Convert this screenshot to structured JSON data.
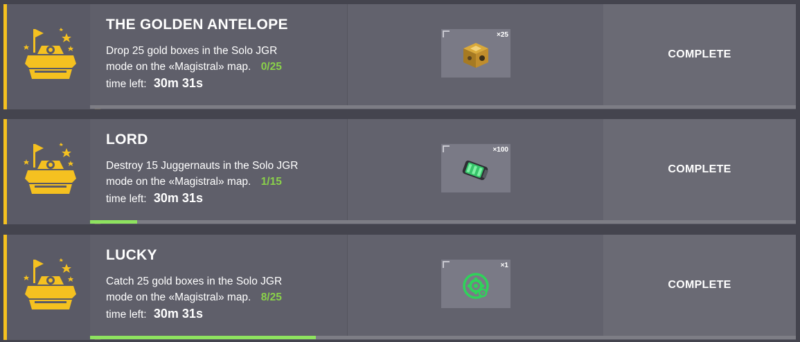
{
  "missions": [
    {
      "title": "THE GOLDEN ANTELOPE",
      "desc_line1": "Drop 25 gold boxes in the Solo JGR",
      "desc_line2": "mode on the «Magistral» map.",
      "progress_text": "0/25",
      "progress": 0.0,
      "time_label": "time left:",
      "time_value": "30m 31s",
      "reward_icon": "gold-box-icon",
      "reward_qty": "×25",
      "action_label": "COMPLETE"
    },
    {
      "title": "LORD",
      "desc_line1": "Destroy 15 Juggernauts in the Solo JGR",
      "desc_line2": "mode on the «Magistral» map.",
      "progress_text": "1/15",
      "progress": 0.0667,
      "time_label": "time left:",
      "time_value": "30m 31s",
      "reward_icon": "battery-icon",
      "reward_qty": "×100",
      "action_label": "COMPLETE"
    },
    {
      "title": "LUCKY",
      "desc_line1": "Catch 25 gold boxes in the Solo JGR",
      "desc_line2": "mode on the «Magistral» map.",
      "progress_text": "8/25",
      "progress": 0.32,
      "time_label": "time left:",
      "time_value": "30m 31s",
      "reward_icon": "gear-icon",
      "reward_qty": "×1",
      "action_label": "COMPLETE"
    }
  ],
  "colors": {
    "accent": "#f5c120",
    "progress_text": "#8ad14a",
    "progress_fill": "#8ee35f",
    "background": "#44444e"
  }
}
